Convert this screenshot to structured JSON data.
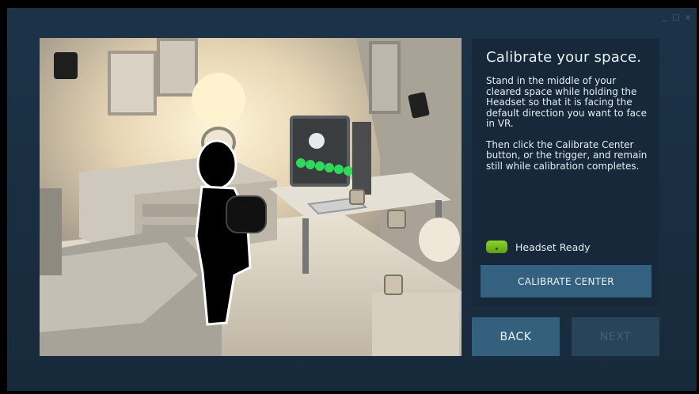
{
  "window": {
    "controls": {
      "minimize": "_",
      "maximize": "□",
      "close": "×"
    }
  },
  "illustration": {
    "subject": "room-scale-calibration-scene",
    "monitor_progress_dots": 6
  },
  "panel": {
    "title": "Calibrate your space.",
    "paragraph_1": "Stand in the middle of your cleared space while holding the Headset so that it is facing the default direction you want to face in VR.",
    "paragraph_2": "Then click the Calibrate Center button, or the trigger, and remain still while calibration completes.",
    "status_label": "Headset Ready",
    "status_color": "#7bc41f",
    "calibrate_button_label": "CALIBRATE CENTER"
  },
  "footer": {
    "back_label": "BACK",
    "next_label": "NEXT",
    "next_enabled": false
  },
  "colors": {
    "background": "#1a2f42",
    "panel": "#16283a",
    "button": "#34607d",
    "button_disabled": "#27445a"
  }
}
